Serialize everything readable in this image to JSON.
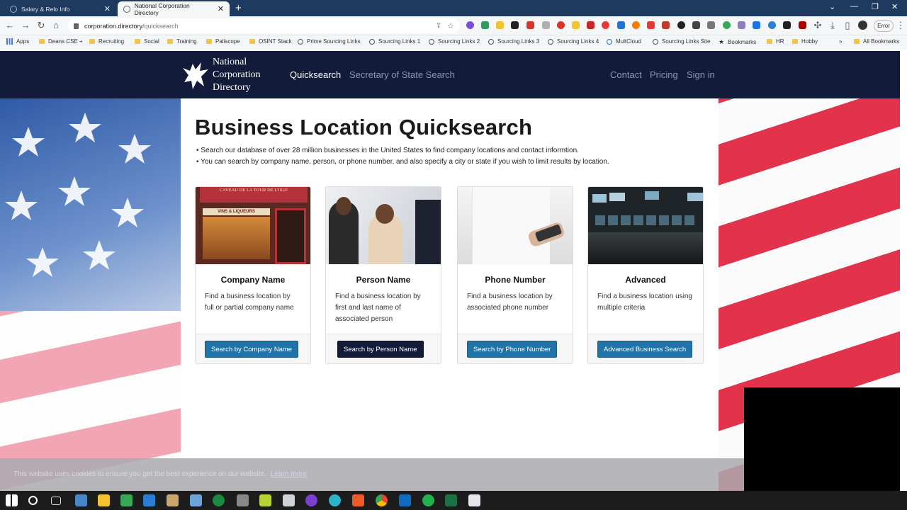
{
  "browser": {
    "tabs": [
      {
        "title": "Salary & Relo Info",
        "active": false
      },
      {
        "title": "National Corporation Directory",
        "active": true
      }
    ],
    "url_domain": "corporation.directory",
    "url_path": "/quicksearch",
    "error_label": "Error",
    "bookmarks": [
      "Apps",
      "Deans CSE +",
      "Recruiting",
      "Social",
      "Training",
      "Paliscope",
      "OSINT Stack",
      "Prime Sourcing Links",
      "Sourcing Links 1",
      "Sourcing Links 2",
      "Sourcing Links 3",
      "Sourcing Links 4",
      "MultCloud",
      "Sourcing Links Site",
      "Bookmarks",
      "HR",
      "Hobby",
      "All Bookmarks"
    ]
  },
  "site": {
    "logo_lines": [
      "National",
      "Corporation",
      "Directory"
    ],
    "nav": {
      "quicksearch": "Quicksearch",
      "sos_search": "Secretary of State Search",
      "contact": "Contact",
      "pricing": "Pricing",
      "signin": "Sign in"
    }
  },
  "main": {
    "title": "Business Location Quicksearch",
    "bullets": [
      "Search our database of over 28 million businesses in the United States to find company locations and contact informtion.",
      "You can search by company name, person, or phone number, and also specify a city or state if you wish to limit results by location."
    ],
    "cards": [
      {
        "title": "Company Name",
        "desc": "Find a business location by full or partial company name",
        "button": "Search by Company Name",
        "shop_sign": "CAVEAU DE LA TOUR DE L'ISLE",
        "shop_awning": "VINS & LIQUEURS"
      },
      {
        "title": "Person Name",
        "desc": "Find a business location by first and last name of associated person",
        "button": "Search by Person Name"
      },
      {
        "title": "Phone Number",
        "desc": "Find a business location by associated phone number",
        "button": "Search by Phone Number"
      },
      {
        "title": "Advanced",
        "desc": "Find a business location using multiple criteria",
        "button": "Advanced Business Search"
      }
    ]
  },
  "cookie": {
    "text": "This website uses cookies to ensure you get the best experience on our website.",
    "link": "Learn more"
  },
  "colors": {
    "navbar": "#131b3a",
    "button": "#2273a8",
    "button_dark": "#131b3a"
  }
}
